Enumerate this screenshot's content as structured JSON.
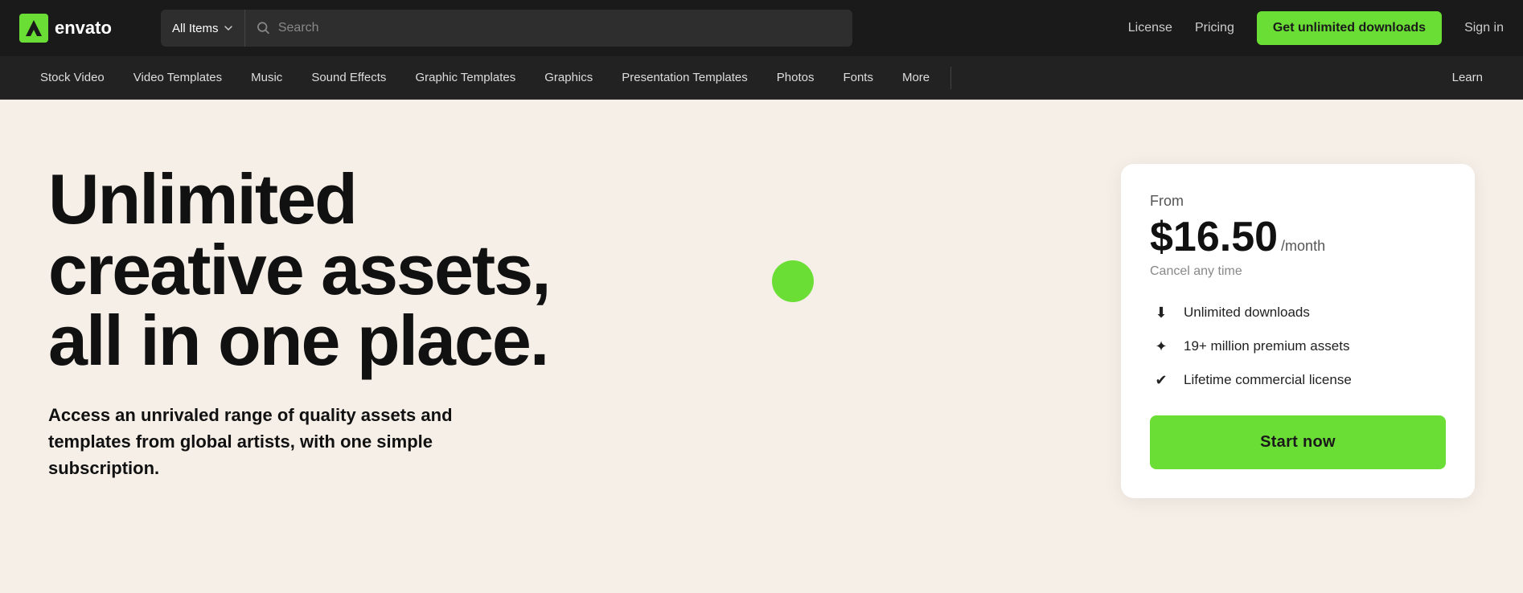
{
  "header": {
    "logo_text": "envato",
    "search_dropdown_label": "All Items",
    "search_placeholder": "Search",
    "nav_license": "License",
    "nav_pricing": "Pricing",
    "btn_unlimited": "Get unlimited downloads",
    "nav_signin": "Sign in"
  },
  "secondary_nav": {
    "items": [
      {
        "label": "Stock Video"
      },
      {
        "label": "Video Templates"
      },
      {
        "label": "Music"
      },
      {
        "label": "Sound Effects"
      },
      {
        "label": "Graphic Templates"
      },
      {
        "label": "Graphics"
      },
      {
        "label": "Presentation Templates"
      },
      {
        "label": "Photos"
      },
      {
        "label": "Fonts"
      },
      {
        "label": "More"
      }
    ],
    "learn": "Learn"
  },
  "hero": {
    "title_line1": "Unlimited",
    "title_line2": "creative assets,",
    "title_line3": "all in one place.",
    "subtitle": "Access an unrivaled range of quality assets and templates from global artists, with one simple subscription.",
    "card": {
      "from_label": "From",
      "price": "$16.50",
      "period": "/month",
      "cancel_text": "Cancel any time",
      "features": [
        {
          "icon": "⬇",
          "text": "Unlimited downloads"
        },
        {
          "icon": "✦",
          "text": "19+ million premium assets"
        },
        {
          "icon": "✔",
          "text": "Lifetime commercial license"
        }
      ],
      "cta": "Start now"
    }
  },
  "colors": {
    "accent_green": "#6bde35",
    "bg_hero": "#f5efe8",
    "nav_bg": "#1a1a1a",
    "sec_nav_bg": "#222"
  }
}
